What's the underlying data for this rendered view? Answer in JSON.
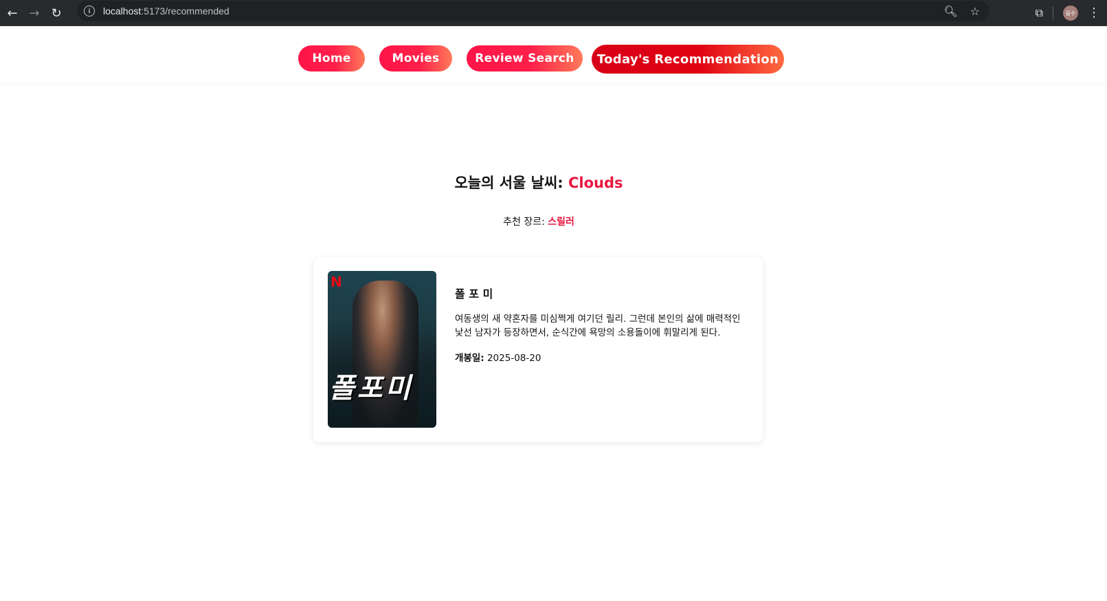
{
  "browser": {
    "url_host": "localhost",
    "url_path": ":5173/recommended",
    "avatar_initials": "응수",
    "icons": [
      "back-icon",
      "forward-icon",
      "reload-icon",
      "site-info-icon",
      "zoom-icon",
      "bookmark-star-icon",
      "extensions-icon",
      "more-menu-icon"
    ]
  },
  "nav": {
    "items": [
      {
        "label": "Home"
      },
      {
        "label": "Movies"
      },
      {
        "label": "Review Search"
      },
      {
        "label": "Today's Recommendation"
      }
    ],
    "active_index": 3
  },
  "weather": {
    "title_prefix": "오늘의 서울 날씨: ",
    "condition": "Clouds"
  },
  "genre": {
    "label": "추천 장르: ",
    "value": "스릴러"
  },
  "movie": {
    "title": "폴 포 미",
    "overview": "여동생의 새 약혼자를 미심쩍게 여기던 릴리. 그런데 본인의 삶에 매력적인 낯선 남자가 등장하면서, 순식간에 욕망의 소용돌이에 휘말리게 된다.",
    "release_label": "개봉일:",
    "release_date": "2025-08-20",
    "poster_brand": "N",
    "poster_title": "폴포미"
  },
  "colors": {
    "accent": "#e8173f",
    "pill_start": "#ff1448",
    "pill_end": "#ff7a5a",
    "active_pill_start": "#d80016"
  }
}
